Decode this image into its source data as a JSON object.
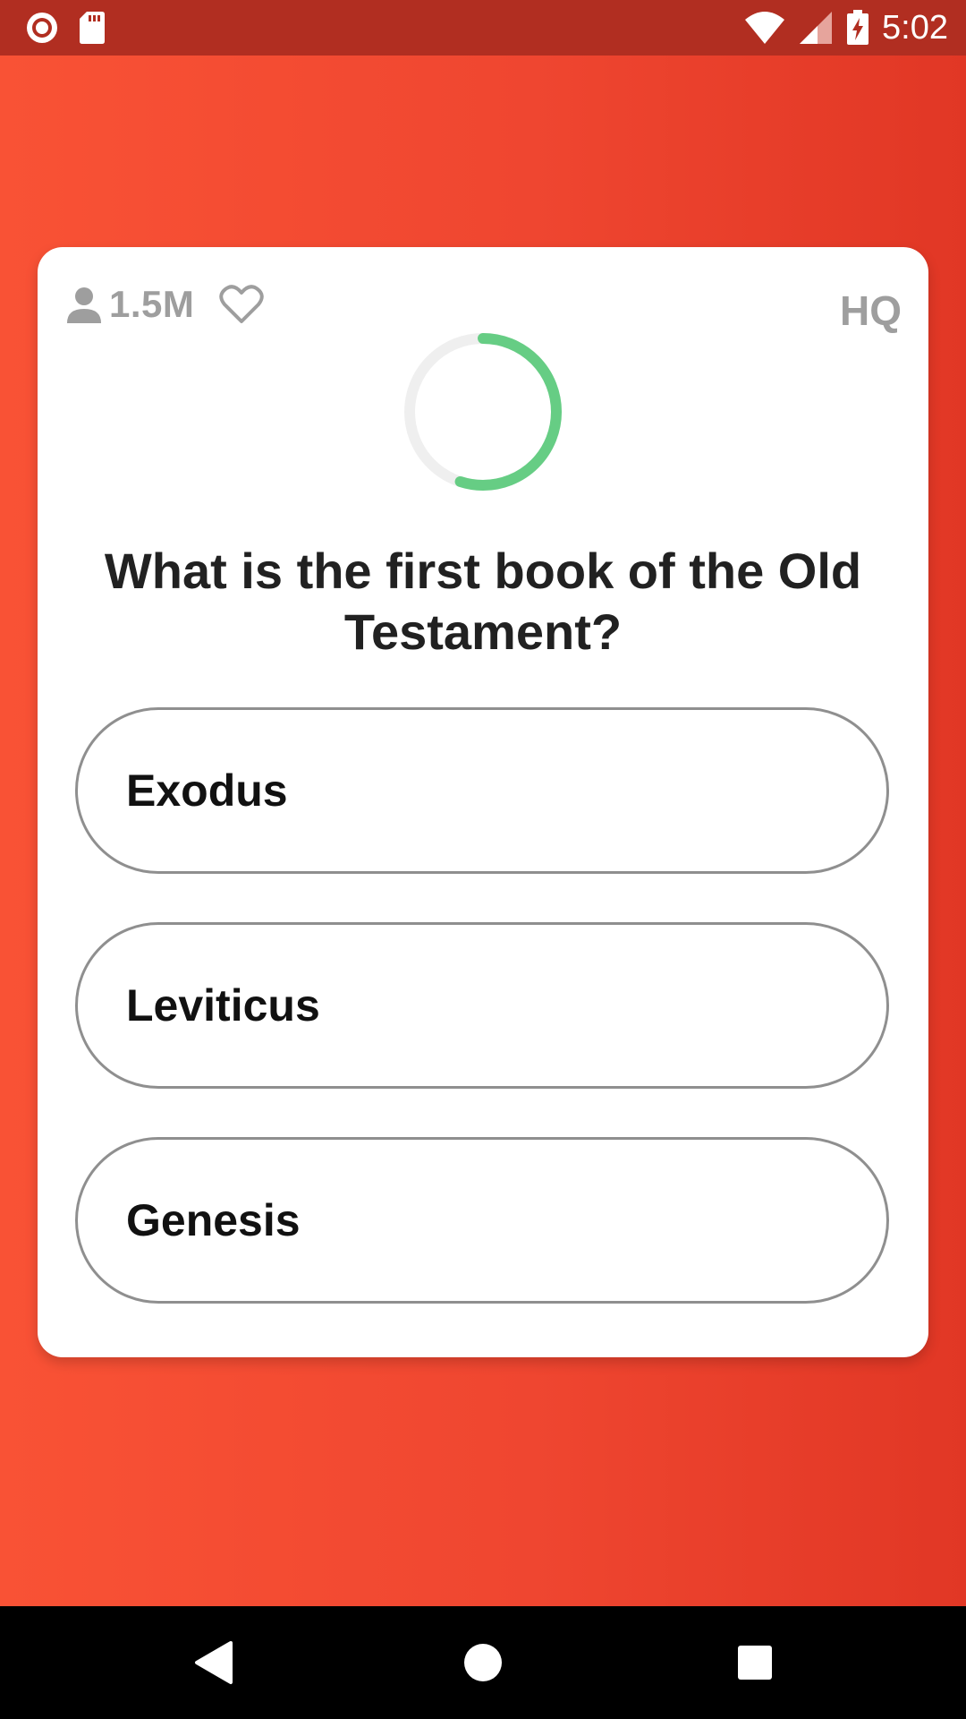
{
  "status_bar": {
    "time": "5:02",
    "left_icons": [
      "record-icon",
      "sd-card-icon"
    ],
    "right_icons": [
      "wifi-icon",
      "signal-icon",
      "battery-charging-icon"
    ],
    "background": "#b12e21"
  },
  "card": {
    "viewer_count": "1.5M",
    "brand": "HQ",
    "timer_progress_fraction": 0.55,
    "timer_color": "#66cd84",
    "question": "What is the first book of the Old Testament?",
    "answers": [
      {
        "label": "Exodus"
      },
      {
        "label": "Leviticus"
      },
      {
        "label": "Genesis"
      }
    ]
  },
  "nav_bar": {
    "buttons": [
      "back-icon",
      "home-icon",
      "recents-icon"
    ]
  },
  "colors": {
    "background_gradient": [
      "#f95235",
      "#e13725"
    ],
    "muted_text": "#9e9e9e",
    "answer_border": "#8f8f8f"
  }
}
